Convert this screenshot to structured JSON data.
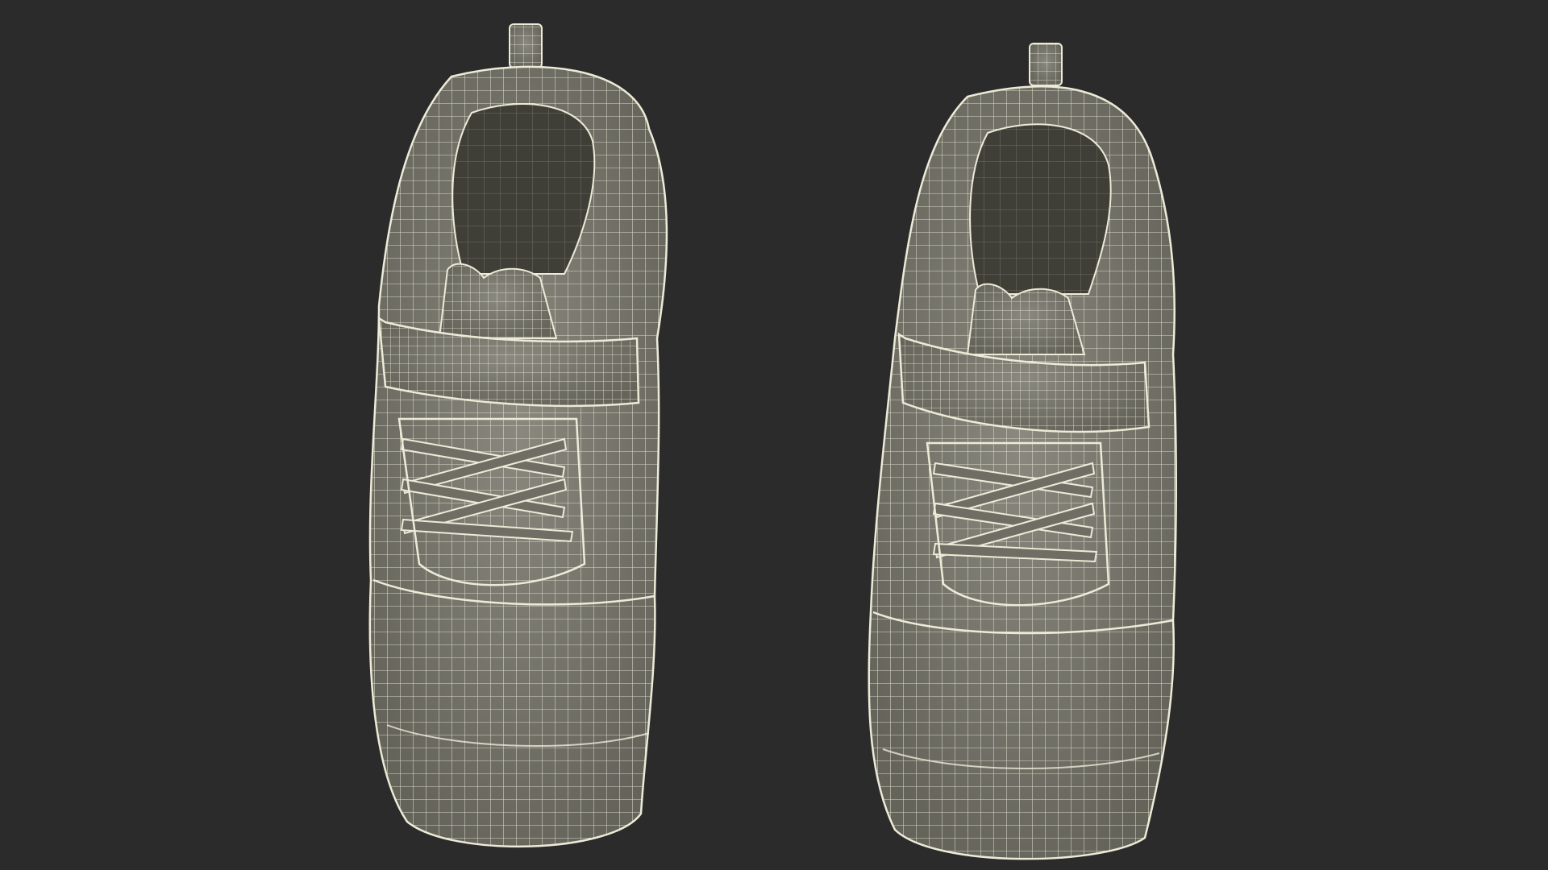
{
  "scene": {
    "background_color": "#2b2b2b",
    "mesh_fill_color": "#7d7c72",
    "mesh_shadow_color": "#5e5d55",
    "insole_color": "#3f3f38",
    "wire_color": "#ecebd8",
    "objects": [
      {
        "name": "left-sneaker",
        "kind": "wireframe-3d-model"
      },
      {
        "name": "right-sneaker",
        "kind": "wireframe-3d-model"
      }
    ]
  }
}
